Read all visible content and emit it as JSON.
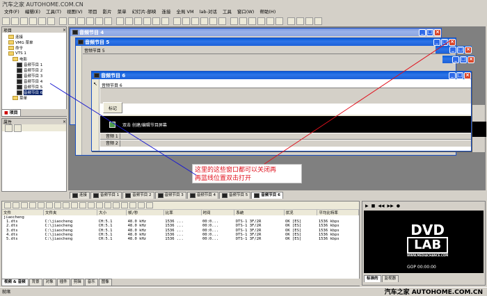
{
  "app": {
    "title": "汽车之家 AUTOHOME.COM.CN"
  },
  "menu": [
    "文件(F)",
    "编辑(E)",
    "工具(T)",
    "视图(V)",
    "项目",
    "影片",
    "菜单",
    "幻灯片-部映",
    "连接",
    "全局 VM",
    "lab-对话",
    "工具",
    "窗口(W)",
    "帮助(H)"
  ],
  "project_panel": {
    "title": "项目",
    "tree": [
      {
        "label": "连接",
        "depth": 1,
        "icon": "link-icon"
      },
      {
        "label": "VMG 菜单",
        "depth": 1,
        "icon": "folder-icon"
      },
      {
        "label": "命令",
        "depth": 1,
        "icon": "folder-icon"
      },
      {
        "label": "VTS 1",
        "depth": 1,
        "icon": "folder-icon"
      },
      {
        "label": "电影",
        "depth": 2,
        "icon": "folder-icon"
      },
      {
        "label": "音频节目 1",
        "depth": 3,
        "icon": "film-icon"
      },
      {
        "label": "音频节目 2",
        "depth": 3,
        "icon": "film-icon"
      },
      {
        "label": "音频节目 3",
        "depth": 3,
        "icon": "film-icon"
      },
      {
        "label": "音频节目 4",
        "depth": 3,
        "icon": "film-icon"
      },
      {
        "label": "音频节目 5",
        "depth": 3,
        "icon": "film-icon"
      },
      {
        "label": "音频节目 6",
        "depth": 3,
        "icon": "film-icon"
      },
      {
        "label": "菜单",
        "depth": 2,
        "icon": "folder-icon"
      }
    ],
    "tab": "项目"
  },
  "props_panel": {
    "title": "属性"
  },
  "windows": [
    {
      "title": "音频节目 4"
    },
    {
      "title": "音频节目 5",
      "inner": "音频节目 5"
    },
    {
      "title": "音频节目 6",
      "inner": "音频节目 6",
      "marker": "标记",
      "hint": "双击 创建/编辑节目屏幕",
      "track1": "音频 1",
      "track2": "音频 2"
    }
  ],
  "annotation": {
    "line1": "这里的这些窗口都可以关闭再",
    "line2": "再蓝线位置双击打开"
  },
  "doc_tabs": [
    "连接",
    "音频节目 1",
    "音频节目 2",
    "音频节目 3",
    "音频节目 4",
    "音频节目 5",
    "音频节目 6"
  ],
  "file_list": {
    "columns": [
      "文件",
      "文件夹",
      "大小",
      "帧/秒",
      "比率",
      "时间",
      "系统",
      "状况",
      "平均比特率"
    ],
    "folder": "jiaocheng",
    "rows": [
      [
        "1.dts",
        "C:\\jiaocheng",
        "CH:5.1",
        "48.0 kHz",
        "1536 ...",
        "00:0...",
        "DTS-1 3F/2R",
        "OK [ES]",
        "1536 kbps"
      ],
      [
        "2.dts",
        "C:\\jiaocheng",
        "CH:5.1",
        "48.0 kHz",
        "1536 ...",
        "00:0...",
        "DTS-1 3F/2R",
        "OK [ES]",
        "1536 kbps"
      ],
      [
        "3.dts",
        "C:\\jiaocheng",
        "CH:5.1",
        "48.0 kHz",
        "1536 ...",
        "00:0...",
        "DTS-1 3F/2R",
        "OK [ES]",
        "1536 kbps"
      ],
      [
        "4.dts",
        "C:\\jiaocheng",
        "CH:5.1",
        "48.0 kHz",
        "1536 ...",
        "00:0...",
        "DTS-1 3F/2R",
        "OK [ES]",
        "1536 kbps"
      ],
      [
        "5.dts",
        "C:\\jiaocheng",
        "CH:5.1",
        "48.0 kHz",
        "1536 ...",
        "00:0...",
        "DTS-1 3F/2R",
        "OK [ES]",
        "1536 kbps"
      ]
    ],
    "bottom_tabs": [
      "视频 & 音频",
      "背景",
      "对象",
      "插件",
      "剪辑",
      "音乐",
      "图像"
    ]
  },
  "preview": {
    "logo_top": "DVD",
    "logo_bottom": "LAB",
    "site": "WWW.MEDIACHANCE.COM",
    "gop": "GOP 00:00:00",
    "tabs": [
      "标准的",
      "监视器"
    ]
  },
  "status": {
    "text": "就绪"
  },
  "watermark": "汽车之家 AUTOHOME.COM.CN",
  "colors": {
    "xp_blue": "#0a5bd6",
    "annotation_red": "#e0101c",
    "line_blue": "#1b1bd0"
  }
}
